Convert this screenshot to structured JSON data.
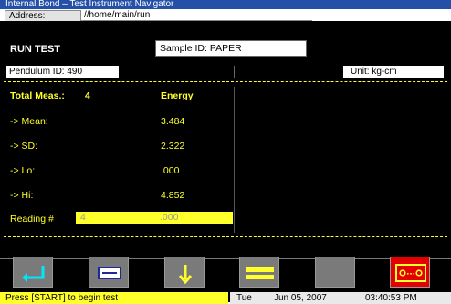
{
  "window": {
    "title": "Internal Bond – Test Instrument Navigator"
  },
  "address": {
    "label": "Address:",
    "value": "//home/main/run"
  },
  "header": {
    "run_label": "RUN TEST",
    "sample_id": "Sample ID: PAPER"
  },
  "info": {
    "pendulum_id": "Pendulum ID: 490",
    "unit": "Unit: kg-cm"
  },
  "stats": {
    "total_label": "Total Meas.:",
    "total_value": "4",
    "column_header": "Energy",
    "rows": [
      {
        "label": "-> Mean:",
        "value": "3.484"
      },
      {
        "label": "-> SD:",
        "value": "2.322"
      },
      {
        "label": "-> Lo:",
        "value": ".000"
      },
      {
        "label": "-> Hi:",
        "value": "4.852"
      }
    ]
  },
  "reading": {
    "label": "Reading #",
    "number": "4",
    "value": ".000"
  },
  "toolbar": {
    "buttons": [
      {
        "name": "enter-button",
        "icon": "enter-arrow-icon",
        "color": "#7a7a7a"
      },
      {
        "name": "keyboard-button",
        "icon": "keyboard-icon",
        "color": "#7a7a7a"
      },
      {
        "name": "down-arrow-button",
        "icon": "down-arrow-icon",
        "color": "#7a7a7a"
      },
      {
        "name": "equals-button",
        "icon": "equals-icon",
        "color": "#7a7a7a"
      },
      {
        "name": "blank-button",
        "icon": "",
        "color": "#7a7a7a"
      },
      {
        "name": "dots-button",
        "icon": "ellipsis-icon",
        "color": "#e40000"
      }
    ]
  },
  "status": {
    "message": "Press [START] to begin test",
    "day": "Tue",
    "date": "Jun 05, 2007",
    "time": "03:40:53 PM"
  },
  "colors": {
    "accent": "#ffff2c",
    "title_bar": "#2450a8",
    "icon_cyan": "#00e6ff",
    "background": "#000000"
  }
}
